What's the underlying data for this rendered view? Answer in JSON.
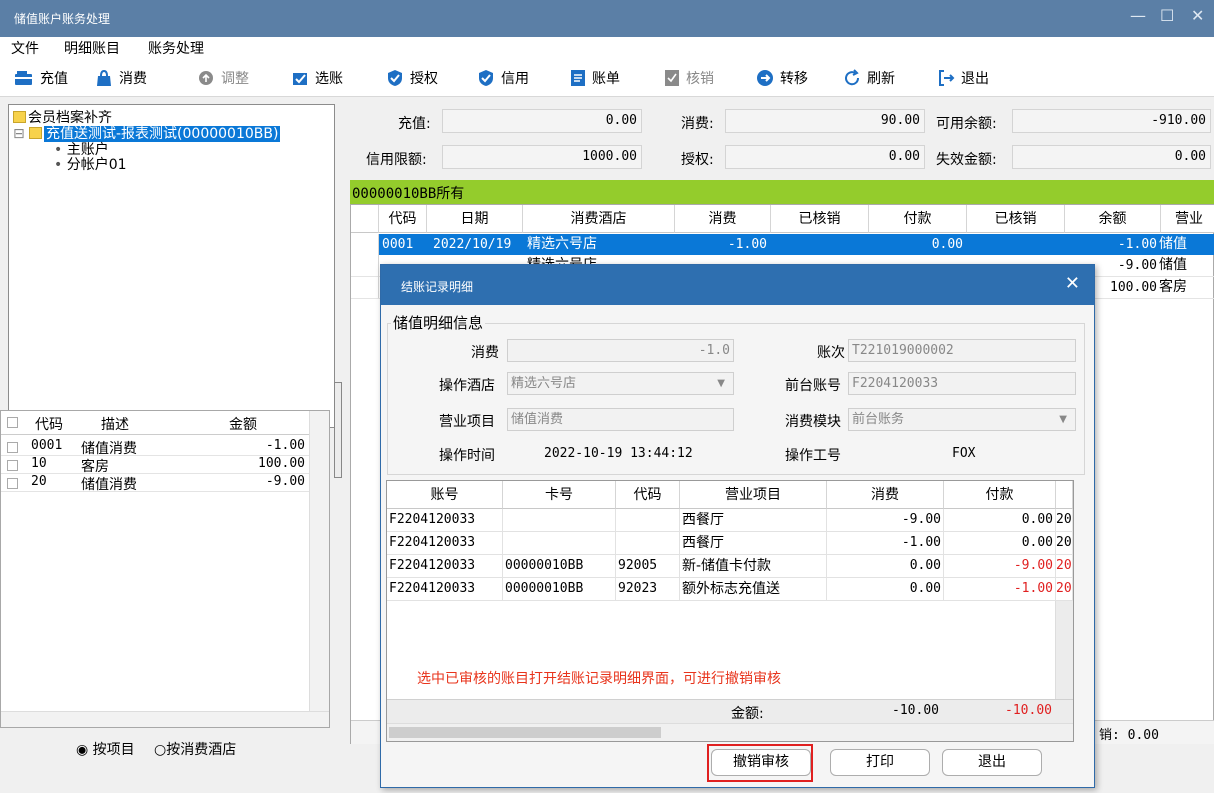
{
  "window": {
    "title": "储值账户账务处理",
    "controls": [
      "—",
      "☐",
      "✕"
    ]
  },
  "menu": [
    "文件",
    "明细账目",
    "账务处理"
  ],
  "toolbar": [
    {
      "label": "充值",
      "icon": "recharge-card-icon",
      "disabled": false
    },
    {
      "label": "消费",
      "icon": "shopping-bag-icon",
      "disabled": false
    },
    {
      "label": "调整",
      "icon": "adjust-icon",
      "disabled": true
    },
    {
      "label": "选账",
      "icon": "select-account-icon",
      "disabled": false
    },
    {
      "label": "授权",
      "icon": "authorize-shield-icon",
      "disabled": false
    },
    {
      "label": "信用",
      "icon": "credit-shield-icon",
      "disabled": false
    },
    {
      "label": "账单",
      "icon": "bill-icon",
      "disabled": false
    },
    {
      "label": "核销",
      "icon": "writeoff-icon",
      "disabled": true
    },
    {
      "label": "转移",
      "icon": "transfer-arrow-icon",
      "disabled": false
    },
    {
      "label": "刷新",
      "icon": "refresh-icon",
      "disabled": false
    },
    {
      "label": "退出",
      "icon": "exit-icon",
      "disabled": false
    }
  ],
  "tree": {
    "root": "会员档案补齐",
    "account": "充值送测试-报表测试(00000010BB)",
    "children": [
      "主账户",
      "分帐户01"
    ]
  },
  "left_grid": {
    "headers": [
      "代码",
      "描述",
      "金额"
    ],
    "rows": [
      [
        "0001",
        "储值消费",
        "-1.00"
      ],
      [
        "10",
        "客房",
        "100.00"
      ],
      [
        "20",
        "储值消费",
        "-9.00"
      ]
    ]
  },
  "radio": {
    "by_item": "按项目",
    "by_hotel": "按消费酒店",
    "selected": "by_item"
  },
  "summary": {
    "recharge_label": "充值:",
    "recharge": "0.00",
    "consume_label": "消费:",
    "consume": "90.00",
    "available_label": "可用余额:",
    "available": "-910.00",
    "credit_label": "信用限额:",
    "credit": "1000.00",
    "auth_label": "授权:",
    "auth": "0.00",
    "expired_label": "失效金额:",
    "expired": "0.00"
  },
  "group_header": "00000010BB所有",
  "main_grid": {
    "headers": [
      "代码",
      "日期",
      "消费酒店",
      "消费",
      "已核销",
      "付款",
      "已核销",
      "余额",
      "营业"
    ],
    "rows": [
      [
        "0001",
        "2022/10/19",
        "精选六号店",
        "-1.00",
        "",
        "0.00",
        "",
        "-1.00",
        "储值"
      ],
      [
        "",
        "",
        "精选六号店",
        "",
        "",
        "",
        "",
        "-9.00",
        "储值"
      ],
      [
        "",
        "",
        "",
        "",
        "",
        "",
        "",
        "100.00",
        "客房"
      ]
    ],
    "footer_partial": "销: 0.00"
  },
  "dialog": {
    "title": "结账记录明细",
    "group_title": "储值明细信息",
    "fields": {
      "consume_label": "消费",
      "consume": "-1.0",
      "folio_label": "账次",
      "folio": "T221019000002",
      "hotel_label": "操作酒店",
      "hotel": "精选六号店",
      "front_label": "前台账号",
      "front": "F2204120033",
      "item_label": "营业项目",
      "item": "储值消费",
      "module_label": "消费模块",
      "module": "前台账务",
      "time_label": "操作时间",
      "time": "2022-10-19 13:44:12",
      "operator_label": "操作工号",
      "operator": "FOX"
    },
    "grid": {
      "headers": [
        "账号",
        "卡号",
        "代码",
        "营业项目",
        "消费",
        "付款",
        ""
      ],
      "rows": [
        [
          "F2204120033",
          "",
          "",
          "西餐厅",
          "-9.00",
          "0.00",
          "20"
        ],
        [
          "F2204120033",
          "",
          "",
          "西餐厅",
          "-1.00",
          "0.00",
          "20"
        ],
        [
          "F2204120033",
          "00000010BB",
          "92005",
          "新-储值卡付款",
          "0.00",
          "-9.00",
          "20"
        ],
        [
          "F2204120033",
          "00000010BB",
          "92023",
          "额外标志充值送",
          "0.00",
          "-1.00",
          "20"
        ]
      ]
    },
    "annotation": "选中已审核的账目打开结账记录明细界面，可进行撤销审核",
    "total_label": "金额:",
    "total_consume": "-10.00",
    "total_pay": "-10.00",
    "buttons": {
      "undo": "撤销审核",
      "print": "打印",
      "exit": "退出"
    },
    "colors": {
      "negative_pay": "#e02020",
      "annotation": "#e8341c",
      "highlight_border": "#e02020"
    }
  },
  "colors": {
    "titlebar": "#5b7fa6",
    "group_bar": "#94cc2c",
    "selection": "#0a78d7",
    "dialog_title": "#2e6fb0"
  }
}
